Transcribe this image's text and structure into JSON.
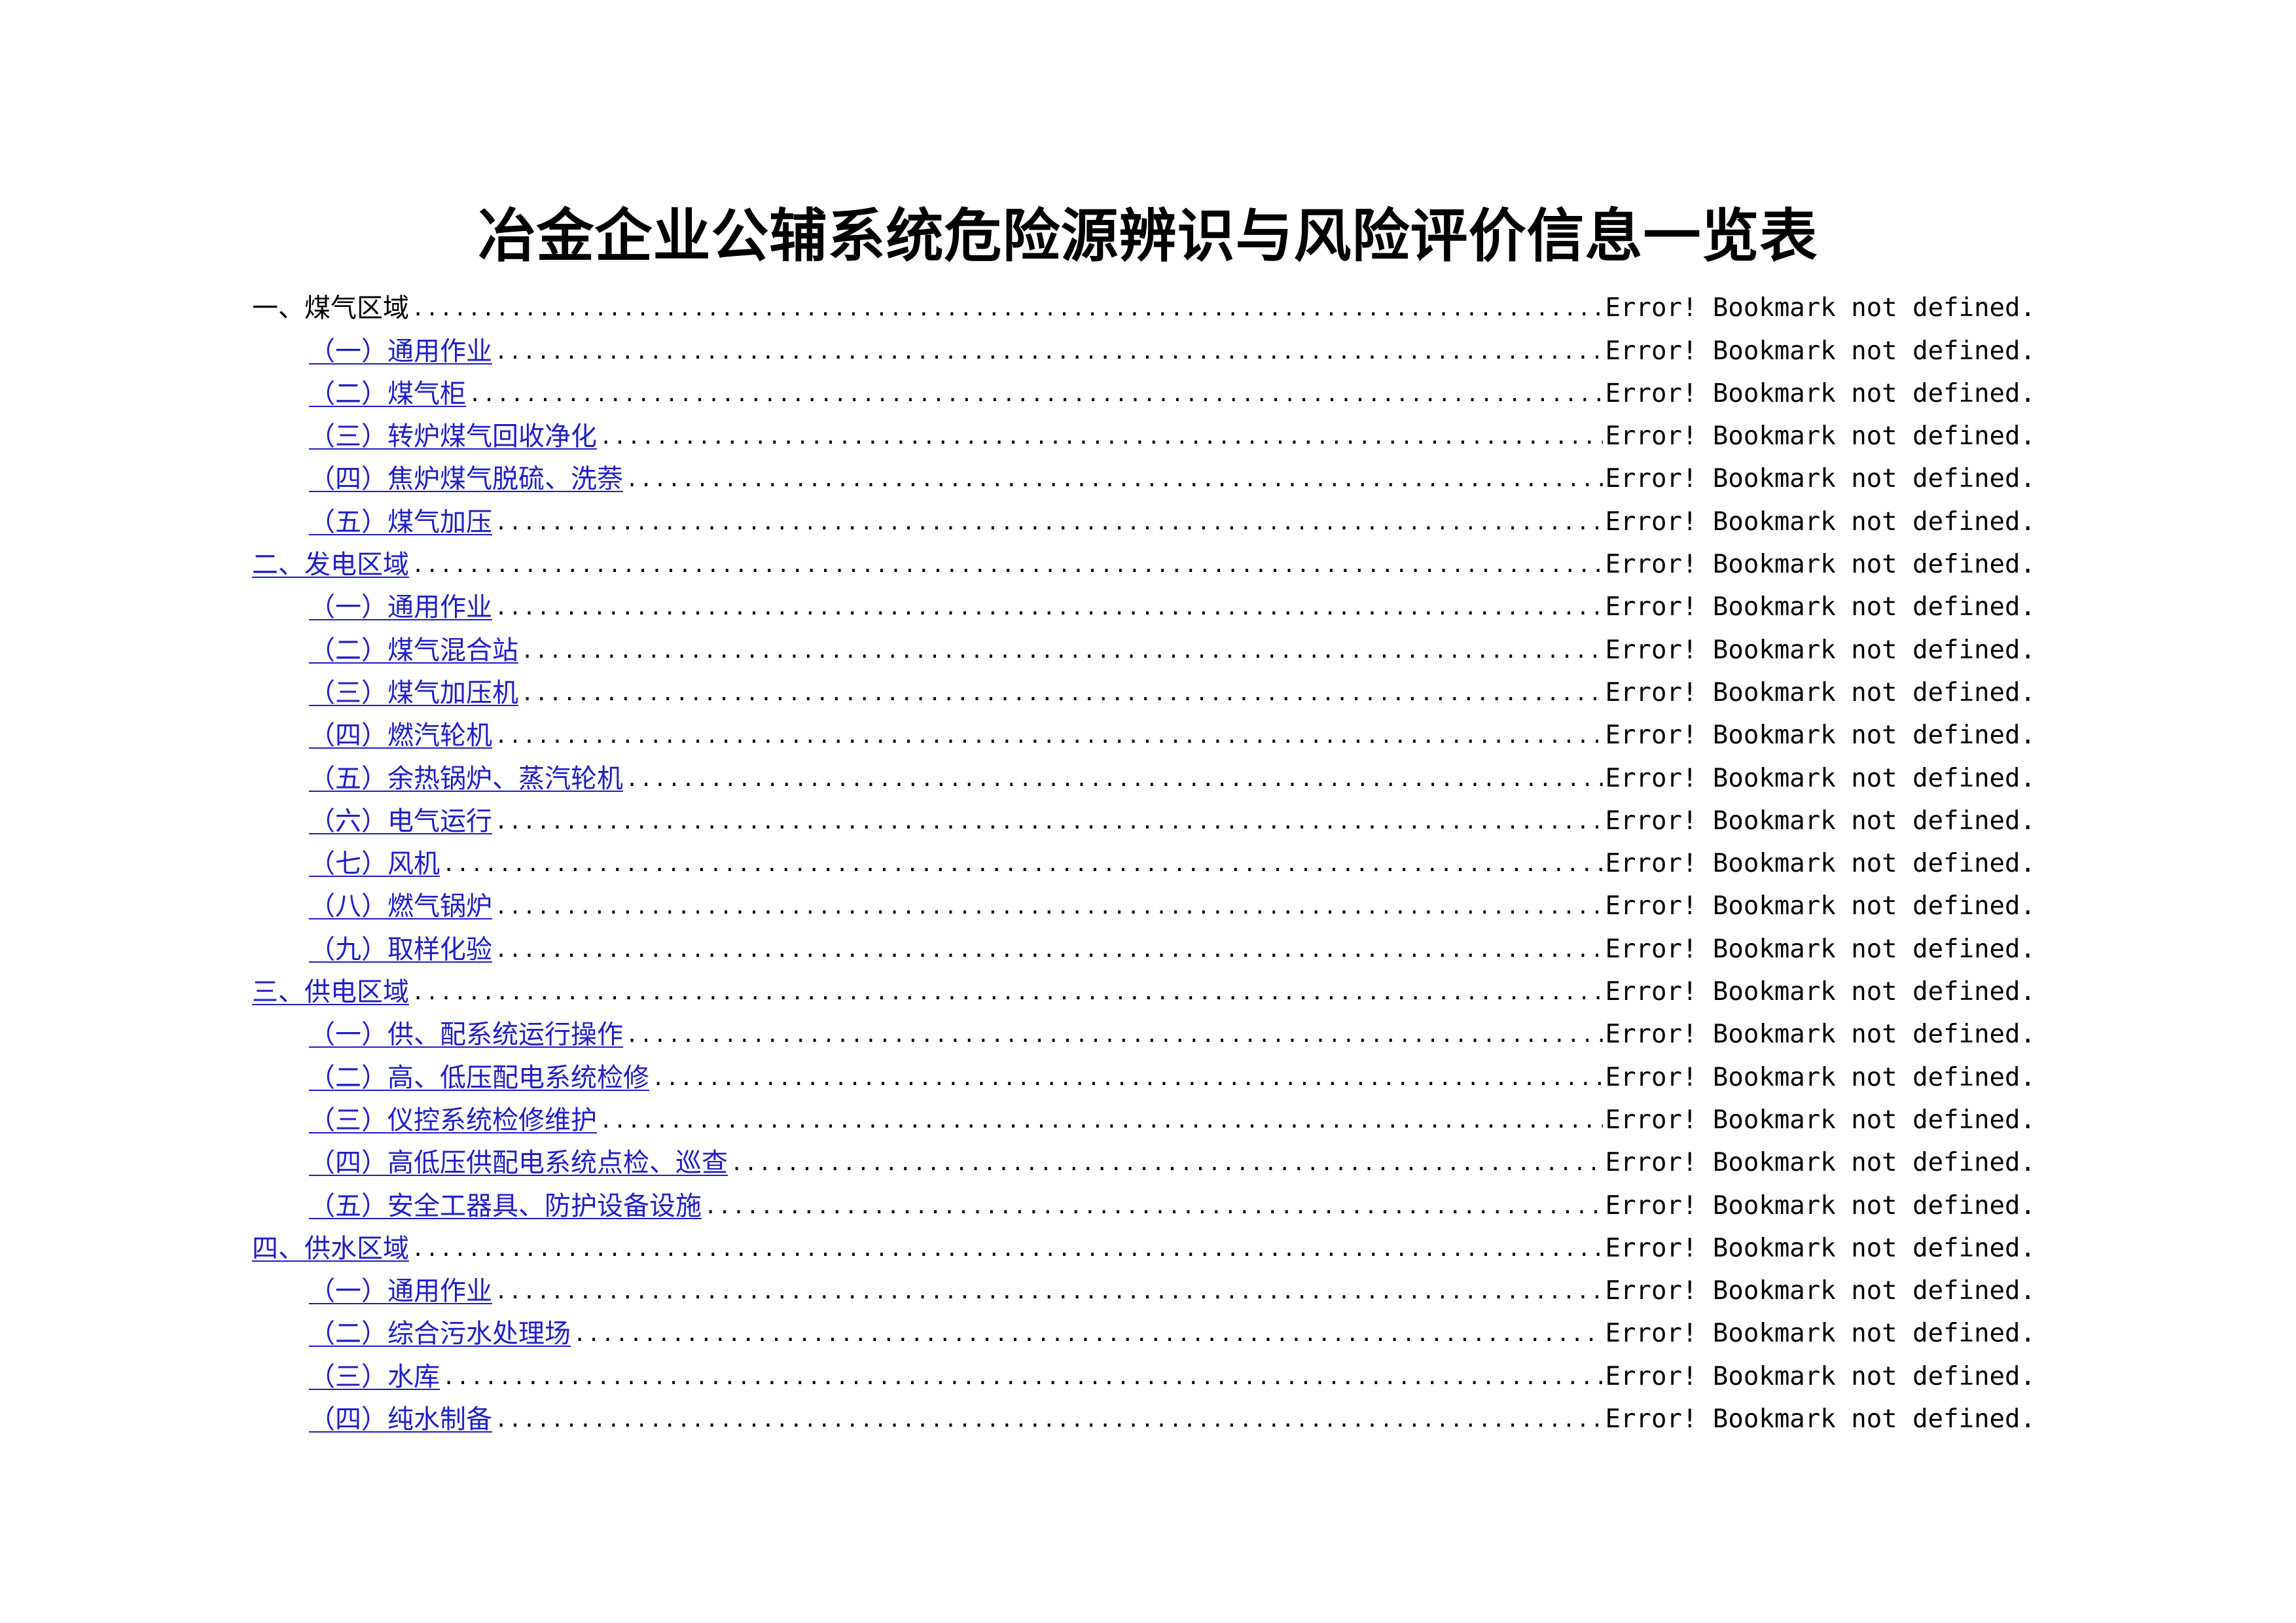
{
  "title": "冶金企业公辅系统危险源辨识与风险评价信息一览表",
  "toc": [
    {
      "label": "一、煤气区域",
      "ref": "Error! Bookmark not defined."
    },
    {
      "label": "（一）通用作业",
      "ref": "Error! Bookmark not defined."
    },
    {
      "label": "（二）煤气柜",
      "ref": "Error! Bookmark not defined."
    },
    {
      "label": "（三）转炉煤气回收净化",
      "ref": "Error! Bookmark not defined."
    },
    {
      "label": "（四）焦炉煤气脱硫、洗萘",
      "ref": "Error! Bookmark not defined."
    },
    {
      "label": "（五）煤气加压",
      "ref": "Error! Bookmark not defined."
    },
    {
      "label": "二、发电区域",
      "ref": "Error! Bookmark not defined."
    },
    {
      "label": "（一）通用作业",
      "ref": "Error! Bookmark not defined."
    },
    {
      "label": "（二）煤气混合站",
      "ref": "Error! Bookmark not defined."
    },
    {
      "label": "（三）煤气加压机",
      "ref": "Error! Bookmark not defined."
    },
    {
      "label": "（四）燃汽轮机",
      "ref": "Error! Bookmark not defined."
    },
    {
      "label": "（五）余热锅炉、蒸汽轮机",
      "ref": "Error! Bookmark not defined."
    },
    {
      "label": "（六）电气运行",
      "ref": "Error! Bookmark not defined."
    },
    {
      "label": "（七）风机",
      "ref": "Error! Bookmark not defined."
    },
    {
      "label": "（八）燃气锅炉",
      "ref": "Error! Bookmark not defined."
    },
    {
      "label": "（九）取样化验",
      "ref": "Error! Bookmark not defined."
    },
    {
      "label": "三、供电区域",
      "ref": "Error! Bookmark not defined."
    },
    {
      "label": "（一）供、配系统运行操作",
      "ref": "Error! Bookmark not defined."
    },
    {
      "label": "（二）高、低压配电系统检修",
      "ref": "Error! Bookmark not defined."
    },
    {
      "label": "（三）仪控系统检修维护",
      "ref": "Error! Bookmark not defined."
    },
    {
      "label": "（四）高低压供配电系统点检、巡查",
      "ref": "Error! Bookmark not defined."
    },
    {
      "label": "（五）安全工器具、防护设备设施",
      "ref": "Error! Bookmark not defined."
    },
    {
      "label": "四、供水区域",
      "ref": "Error! Bookmark not defined."
    },
    {
      "label": "（一）通用作业",
      "ref": "Error! Bookmark not defined."
    },
    {
      "label": "（二）综合污水处理场",
      "ref": "Error! Bookmark not defined."
    },
    {
      "label": "（三）水库",
      "ref": "Error! Bookmark not defined."
    },
    {
      "label": "（四）纯水制备",
      "ref": "Error! Bookmark not defined."
    }
  ]
}
